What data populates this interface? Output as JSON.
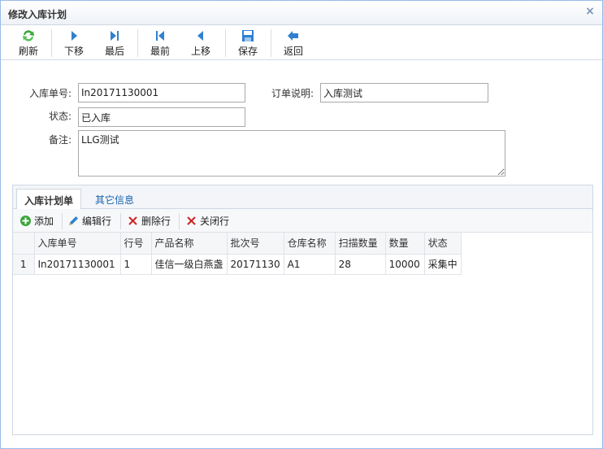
{
  "window": {
    "title": "修改入库计划",
    "close_glyph": "×"
  },
  "toolbar": {
    "refresh": "刷新",
    "next": "下移",
    "last": "最后",
    "first": "最前",
    "prev": "上移",
    "save": "保存",
    "back": "返回"
  },
  "form": {
    "order_no_label": "入库单号:",
    "order_no_value": "In20171130001",
    "order_desc_label": "订单说明:",
    "order_desc_value": "入库测试",
    "status_label": "状态:",
    "status_value": "已入库",
    "remark_label": "备注:",
    "remark_value": "LLG测试"
  },
  "tabs": [
    {
      "label": "入库计划单",
      "active": true
    },
    {
      "label": "其它信息",
      "active": false
    }
  ],
  "grid_toolbar": {
    "add": "添加",
    "edit": "编辑行",
    "delete": "删除行",
    "close": "关闭行"
  },
  "grid": {
    "headers": [
      "入库单号",
      "行号",
      "产品名称",
      "批次号",
      "仓库名称",
      "扫描数量",
      "数量",
      "状态"
    ],
    "rows": [
      {
        "rownum": "1",
        "cells": [
          "In20171130001",
          "1",
          "佳信一级白燕盏",
          "20171130",
          "A1",
          "28",
          "10000",
          "采集中"
        ]
      }
    ]
  },
  "colors": {
    "accent": "#1a64b0",
    "icon_green": "#3aa53a",
    "icon_blue": "#2f80d0",
    "icon_red": "#cc2222"
  }
}
